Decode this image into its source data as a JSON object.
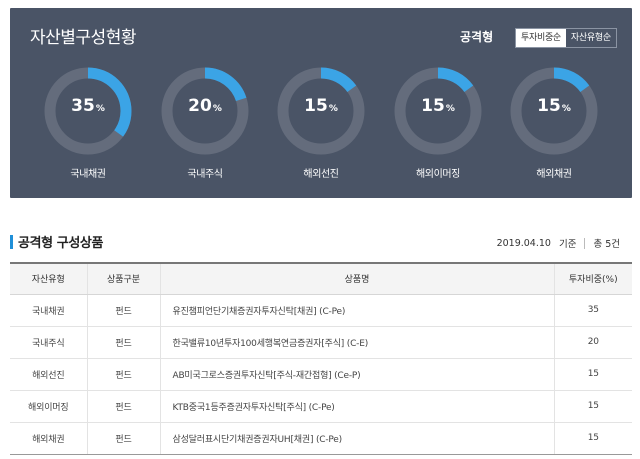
{
  "panel": {
    "title": "자산별구성현황",
    "risk_type": "공격형",
    "sort_buttons": [
      "투자비중순",
      "자산유형순"
    ],
    "active_sort_index": 0,
    "ring_colors": {
      "fill": "#3ba4e6",
      "track": "#646c7c"
    },
    "assets": [
      {
        "label": "국내채권",
        "percent": 35,
        "unit": "%"
      },
      {
        "label": "국내주식",
        "percent": 20,
        "unit": "%"
      },
      {
        "label": "해외선진",
        "percent": 15,
        "unit": "%"
      },
      {
        "label": "해외이머징",
        "percent": 15,
        "unit": "%"
      },
      {
        "label": "해외채권",
        "percent": 15,
        "unit": "%"
      }
    ]
  },
  "section": {
    "title": "공격형 구성상품",
    "date": "2019.04.10",
    "basis": "기준",
    "total": "총 5건"
  },
  "table": {
    "headers": [
      "자산유형",
      "상품구분",
      "상품명",
      "투자비중(%)"
    ],
    "rows": [
      [
        "국내채권",
        "펀드",
        "유진챔피언단기채증권자투자신탁[채권] (C-Pe)",
        "35"
      ],
      [
        "국내주식",
        "펀드",
        "한국밸류10년투자100세행복연금증권자[주식] (C-E)",
        "20"
      ],
      [
        "해외선진",
        "펀드",
        "AB미국그로스증권투자신탁[주식-재간접형] (Ce-P)",
        "15"
      ],
      [
        "해외이머징",
        "펀드",
        "KTB중국1등주증권자투자신탁[주식] (C-Pe)",
        "15"
      ],
      [
        "해외채권",
        "펀드",
        "삼성달러표시단기채권증권자UH[채권] (C-Pe)",
        "15"
      ]
    ]
  }
}
